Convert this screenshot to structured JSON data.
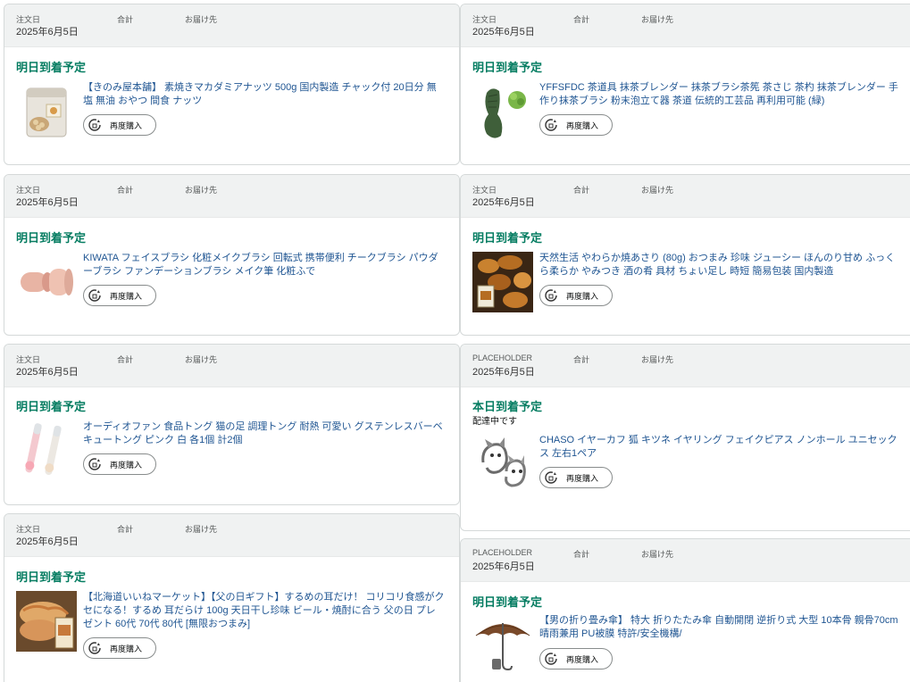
{
  "labels": {
    "total": "合計",
    "ship_to": "お届け先",
    "rebuy": "再度購入"
  },
  "orders": [
    {
      "order_label": "注文日",
      "date": "2025年6月5日",
      "delivery": "明日到着予定",
      "product": "【きのみ屋本舗】 素焼きマカダミアナッツ 500g 国内製造 チャック付 20日分 無塩 無油 おやつ 間食 ナッツ",
      "image": "nuts-bag"
    },
    {
      "order_label": "注文日",
      "date": "2025年6月5日",
      "delivery": "明日到着予定",
      "product": "YFFSFDC 茶道具 抹茶ブレンダー 抹茶ブラシ茶筅 茶さじ 茶杓 抹茶ブレンダー 手作り抹茶ブラシ 粉末泡立て器 茶道 伝統的工芸品 再利用可能 (緑)",
      "image": "matcha-whisk"
    },
    {
      "order_label": "注文日",
      "date": "2025年6月5日",
      "delivery": "明日到着予定",
      "product": "KIWATA フェイスブラシ 化粧メイクブラシ 回転式 携帯便利 チークブラシ パウダーブラシ ファンデーションブラシ メイク筆 化粧ふで",
      "image": "face-brush"
    },
    {
      "order_label": "注文日",
      "date": "2025年6月5日",
      "delivery": "明日到着予定",
      "product": "天然生活 やわらか焼あさり (80g) おつまみ 珍味 ジューシー ほんのり甘め ふっくら柔らか やみつき 酒の肴 具材 ちょい足し 時短 簡易包装 国内製造",
      "image": "grilled-clams"
    },
    {
      "order_label": "注文日",
      "date": "2025年6月5日",
      "delivery": "明日到着予定",
      "product": "オーディオファン 食品トング 猫の足 調理トング 耐熱 可愛い グステンレスバーベキュートング ピンク 白 各1個 計2個",
      "image": "cat-tongs"
    },
    {
      "order_label": "PLACEHOLDER",
      "date": "2025年6月5日",
      "delivery": "本日到着予定",
      "delivery_sub": "配達中です",
      "product": "CHASO イヤーカフ 狐 キツネ イヤリング フェイクピアス ノンホール ユニセックス 左右1ペア",
      "image": "fox-earcuff"
    },
    {
      "order_label": "注文日",
      "date": "2025年6月5日",
      "delivery": "明日到着予定",
      "product": "【北海道いいねマーケット】【父の日ギフト】するめの耳だけ！ コリコリ食感がクセになる！するめ 耳だらけ 100g 天日干し珍味 ビール・焼酎に合う 父の日 プレゼント 60代 70代 80代 [無限おつまみ]",
      "image": "dried-squid"
    },
    {
      "order_label": "PLACEHOLDER",
      "date": "2025年6月5日",
      "delivery": "明日到着予定",
      "product": "【男の折り畳み傘】 特大 折りたたみ傘 自動開閉 逆折り式 大型 10本骨 親骨70cm 晴雨兼用 PU被膜 特許/安全機構/",
      "image": "umbrella"
    }
  ]
}
